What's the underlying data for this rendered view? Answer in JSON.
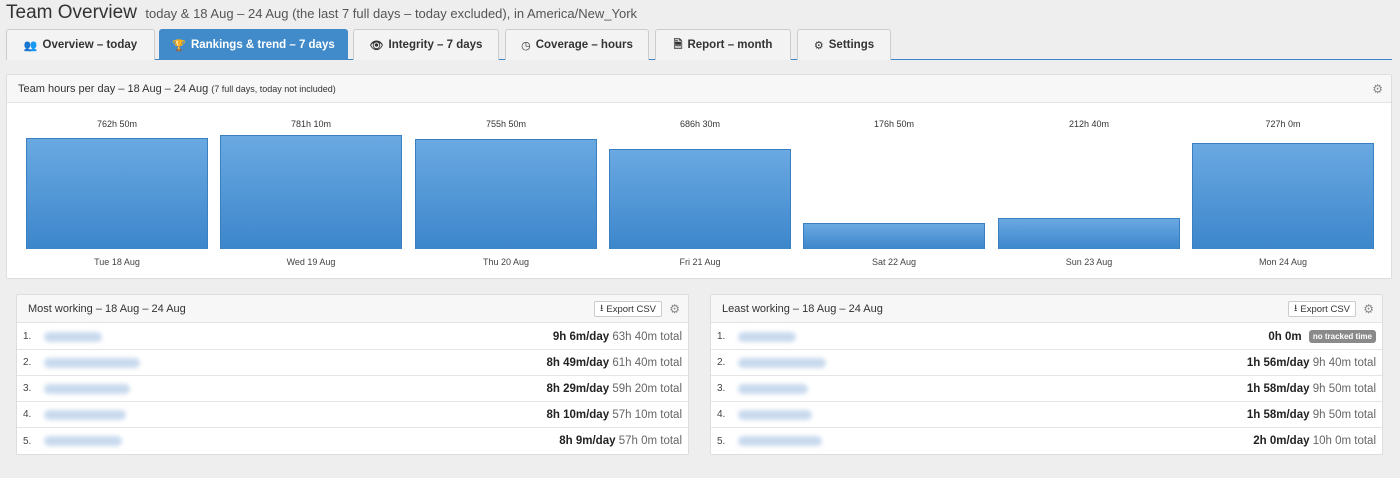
{
  "header": {
    "title": "Team Overview",
    "subtitle": "today & 18 Aug – 24 Aug (the last 7 full days – today excluded), in America/New_York"
  },
  "tabs": [
    {
      "label": "Overview – today",
      "icon": "users-icon",
      "active": false
    },
    {
      "label": "Rankings & trend – 7 days",
      "icon": "trophy-icon",
      "active": true
    },
    {
      "label": "Integrity – 7 days",
      "icon": "eye-icon",
      "active": false
    },
    {
      "label": "Coverage – hours",
      "icon": "clock-icon",
      "active": false
    },
    {
      "label": "Report – month",
      "icon": "document-icon",
      "active": false
    },
    {
      "label": "Settings",
      "icon": "gear-icon",
      "active": false
    }
  ],
  "hours_panel": {
    "title": "Team hours per day – 18 Aug – 24 Aug",
    "note": "(7 full days, today not included)"
  },
  "chart_data": {
    "type": "bar",
    "categories": [
      "Tue 18 Aug",
      "Wed 19 Aug",
      "Thu 20 Aug",
      "Fri 21 Aug",
      "Sat 22 Aug",
      "Sun 23 Aug",
      "Mon 24 Aug"
    ],
    "values": [
      762.83,
      781.17,
      755.83,
      686.5,
      176.83,
      212.67,
      727.0
    ],
    "value_labels": [
      "762h 50m",
      "781h 10m",
      "755h 50m",
      "686h 30m",
      "176h 50m",
      "212h 40m",
      "727h 0m"
    ],
    "ylim": [
      0,
      781.17
    ],
    "color": "#4a92d6"
  },
  "most": {
    "title": "Most working – 18 Aug – 24 Aug",
    "export_label": "Export CSV",
    "rows": [
      {
        "num": "1.",
        "per_day": "9h 6m/day",
        "total": "63h 40m total",
        "badge": ""
      },
      {
        "num": "2.",
        "per_day": "8h 49m/day",
        "total": "61h 40m total",
        "badge": ""
      },
      {
        "num": "3.",
        "per_day": "8h 29m/day",
        "total": "59h 20m total",
        "badge": ""
      },
      {
        "num": "4.",
        "per_day": "8h 10m/day",
        "total": "57h 10m total",
        "badge": ""
      },
      {
        "num": "5.",
        "per_day": "8h 9m/day",
        "total": "57h 0m total",
        "badge": ""
      }
    ]
  },
  "least": {
    "title": "Least working – 18 Aug – 24 Aug",
    "export_label": "Export CSV",
    "rows": [
      {
        "num": "1.",
        "per_day": "0h 0m",
        "total": "",
        "badge": "no tracked time"
      },
      {
        "num": "2.",
        "per_day": "1h 56m/day",
        "total": "9h 40m total",
        "badge": ""
      },
      {
        "num": "3.",
        "per_day": "1h 58m/day",
        "total": "9h 50m total",
        "badge": ""
      },
      {
        "num": "4.",
        "per_day": "1h 58m/day",
        "total": "9h 50m total",
        "badge": ""
      },
      {
        "num": "5.",
        "per_day": "2h 0m/day",
        "total": "10h 0m total",
        "badge": ""
      }
    ]
  }
}
